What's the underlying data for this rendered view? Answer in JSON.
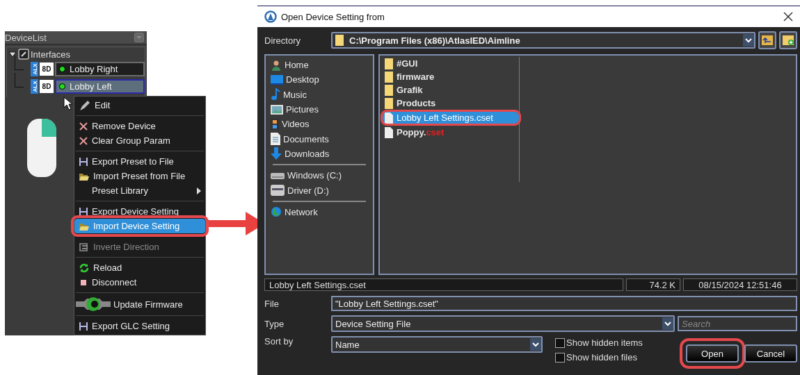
{
  "device_list": {
    "title": "DeviceList",
    "root": {
      "label": "Interfaces",
      "expanded": true,
      "children": [
        {
          "series": "ALX",
          "model": "8D",
          "name": "Lobby Right",
          "online": true,
          "selected": false
        },
        {
          "series": "ALX",
          "model": "8D",
          "name": "Lobby Left",
          "online": true,
          "selected": true
        }
      ]
    }
  },
  "context_menu": {
    "groups": [
      [
        {
          "label": "Edit",
          "kind": "pen",
          "selected": false,
          "disabled": false,
          "submenu": false,
          "highlighted": false
        }
      ],
      [
        {
          "label": "Remove Device",
          "kind": "cross",
          "selected": false,
          "disabled": false,
          "submenu": false,
          "highlighted": false
        },
        {
          "label": "Clear Group Param",
          "kind": "cross",
          "selected": false,
          "disabled": false,
          "submenu": false,
          "highlighted": false
        }
      ],
      [
        {
          "label": "Export Preset to File",
          "kind": "save",
          "selected": false,
          "disabled": false,
          "submenu": false,
          "highlighted": false
        },
        {
          "label": "Import Preset from File",
          "kind": "folder",
          "selected": false,
          "disabled": false,
          "submenu": false,
          "highlighted": false
        },
        {
          "label": "Preset Library",
          "kind": "plain",
          "selected": false,
          "disabled": false,
          "submenu": true,
          "highlighted": false
        }
      ],
      [
        {
          "label": "Export Device Setting",
          "kind": "save",
          "selected": false,
          "disabled": false,
          "submenu": false,
          "highlighted": false
        },
        {
          "label": "Import Device Setting",
          "kind": "folder",
          "selected": true,
          "disabled": false,
          "submenu": false,
          "highlighted": true
        }
      ],
      [
        {
          "label": "Inverte Direction",
          "kind": "invert",
          "selected": false,
          "disabled": true,
          "submenu": false,
          "highlighted": false
        }
      ],
      [
        {
          "label": "Reload",
          "kind": "reload",
          "selected": false,
          "disabled": false,
          "submenu": false,
          "highlighted": false
        },
        {
          "label": "Disconnect",
          "kind": "square",
          "selected": false,
          "disabled": false,
          "submenu": false,
          "highlighted": false
        }
      ],
      [
        {
          "label": "Update Firmware",
          "kind": "gear",
          "selected": false,
          "disabled": false,
          "submenu": false,
          "highlighted": false
        }
      ],
      [
        {
          "label": "Export GLC Setting",
          "kind": "save",
          "selected": false,
          "disabled": false,
          "submenu": false,
          "highlighted": false
        }
      ]
    ]
  },
  "dialog": {
    "title": "Open Device Setting from",
    "directory_label": "Directory",
    "directory": "C:\\Program Files (x86)\\AtlasIED\\Aimline",
    "places": [
      [
        {
          "label": "Home",
          "kind": "person"
        },
        {
          "label": "Desktop",
          "kind": "desktop"
        },
        {
          "label": "Music",
          "kind": "note"
        },
        {
          "label": "Pictures",
          "kind": "picture"
        },
        {
          "label": "Videos",
          "kind": "film"
        },
        {
          "label": "Documents",
          "kind": "document"
        },
        {
          "label": "Downloads",
          "kind": "download"
        }
      ],
      [
        {
          "label": "Windows (C:)",
          "kind": "drive"
        },
        {
          "label": "Driver (D:)",
          "kind": "disc"
        }
      ],
      [
        {
          "label": "Network",
          "kind": "globe"
        }
      ]
    ],
    "files": [
      {
        "name": "#GUI",
        "kind": "folder",
        "selected": false,
        "highlighted": false
      },
      {
        "name": "firmware",
        "kind": "folder",
        "selected": false,
        "highlighted": false
      },
      {
        "name": "Grafik",
        "kind": "folder",
        "selected": false,
        "highlighted": false
      },
      {
        "name": "Products",
        "kind": "folder",
        "selected": false,
        "highlighted": false
      },
      {
        "name": "Lobby Left Settings.cset",
        "kind": "file",
        "selected": true,
        "highlighted": true
      },
      {
        "name": "Poppy.",
        "ext": "cset",
        "kind": "file",
        "selected": false,
        "highlighted": false
      }
    ],
    "status": {
      "name": "Lobby Left Settings.cset",
      "size": "74.2 K",
      "modified": "08/15/2024 12:51:46"
    },
    "file_label": "File",
    "file_value": "\"Lobby Left Settings.cset\"",
    "type_label": "Type",
    "type_value": "Device Setting File",
    "search": {
      "placeholder": "Search"
    },
    "sort_label": "Sort by",
    "sort_value": "Name",
    "options": [
      {
        "label": "Show hidden items",
        "checked": false
      },
      {
        "label": "Show hidden files",
        "checked": false
      }
    ],
    "buttons": [
      {
        "label": "Open",
        "highlighted": true
      },
      {
        "label": "Cancel",
        "highlighted": false
      }
    ]
  }
}
